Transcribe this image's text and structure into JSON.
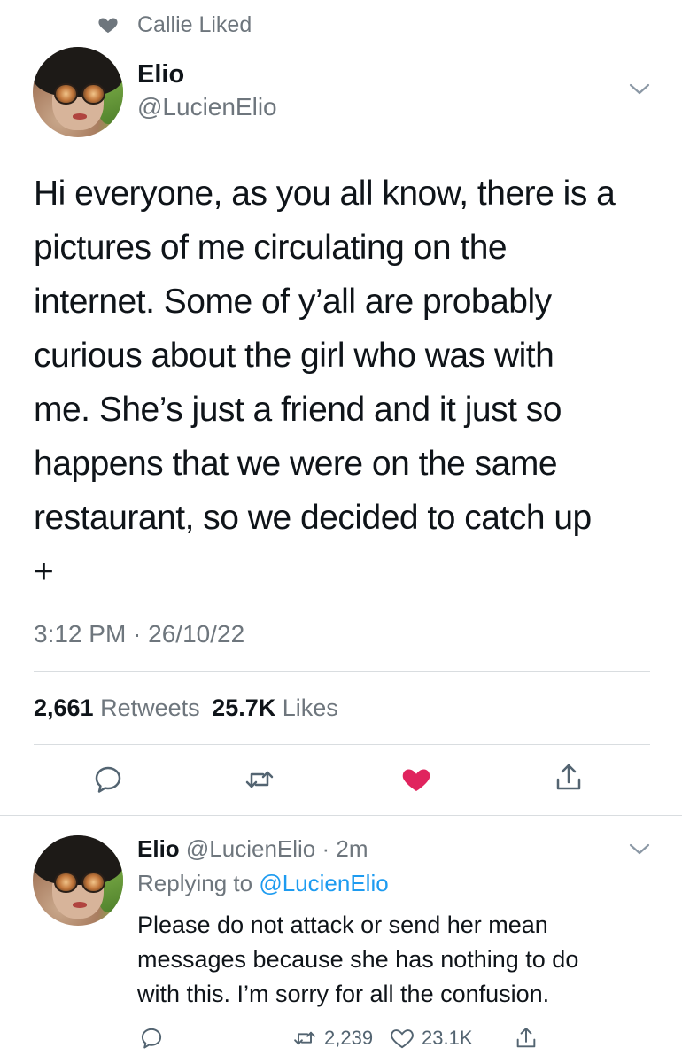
{
  "liked_by": {
    "text": "Callie Liked"
  },
  "tweet": {
    "author_name": "Elio",
    "author_handle": "@LucienElio",
    "lines": [
      "Hi everyone, as you all know, there is a",
      "pictures of me circulating on the",
      "internet. Some of y’all are probably",
      "curious about the girl who was with",
      "me. She’s just a friend and it just so",
      "happens that we were on the same",
      "restaurant, so we decided to catch up",
      "+"
    ],
    "timestamp": "3:12 PM · 26/10/22",
    "retweets_count": "2,661",
    "retweets_label": "Retweets",
    "likes_count": "25.7K",
    "likes_label": "Likes",
    "liked": true
  },
  "reply": {
    "author_name": "Elio",
    "author_handle": "@LucienElio",
    "time": "· 2m",
    "replying_prefix": "Replying to",
    "replying_handle": "@LucienElio",
    "lines": [
      "Please do not attack or send her mean",
      "messages because she has nothing to do",
      "with this. I’m sorry for all the confusion."
    ],
    "retweet_count": "2,239",
    "like_count": "23.1K"
  },
  "icons": {
    "liked_heart": "heart-icon",
    "chevron": "chevron-down-icon",
    "reply": "reply-icon",
    "retweet": "retweet-icon",
    "like": "like-icon",
    "share": "share-icon"
  },
  "colors": {
    "text": "#0f1419",
    "muted": "#6e767d",
    "link": "#1d9bf0",
    "like_active": "#e0245e",
    "divider": "#d9dde0"
  }
}
